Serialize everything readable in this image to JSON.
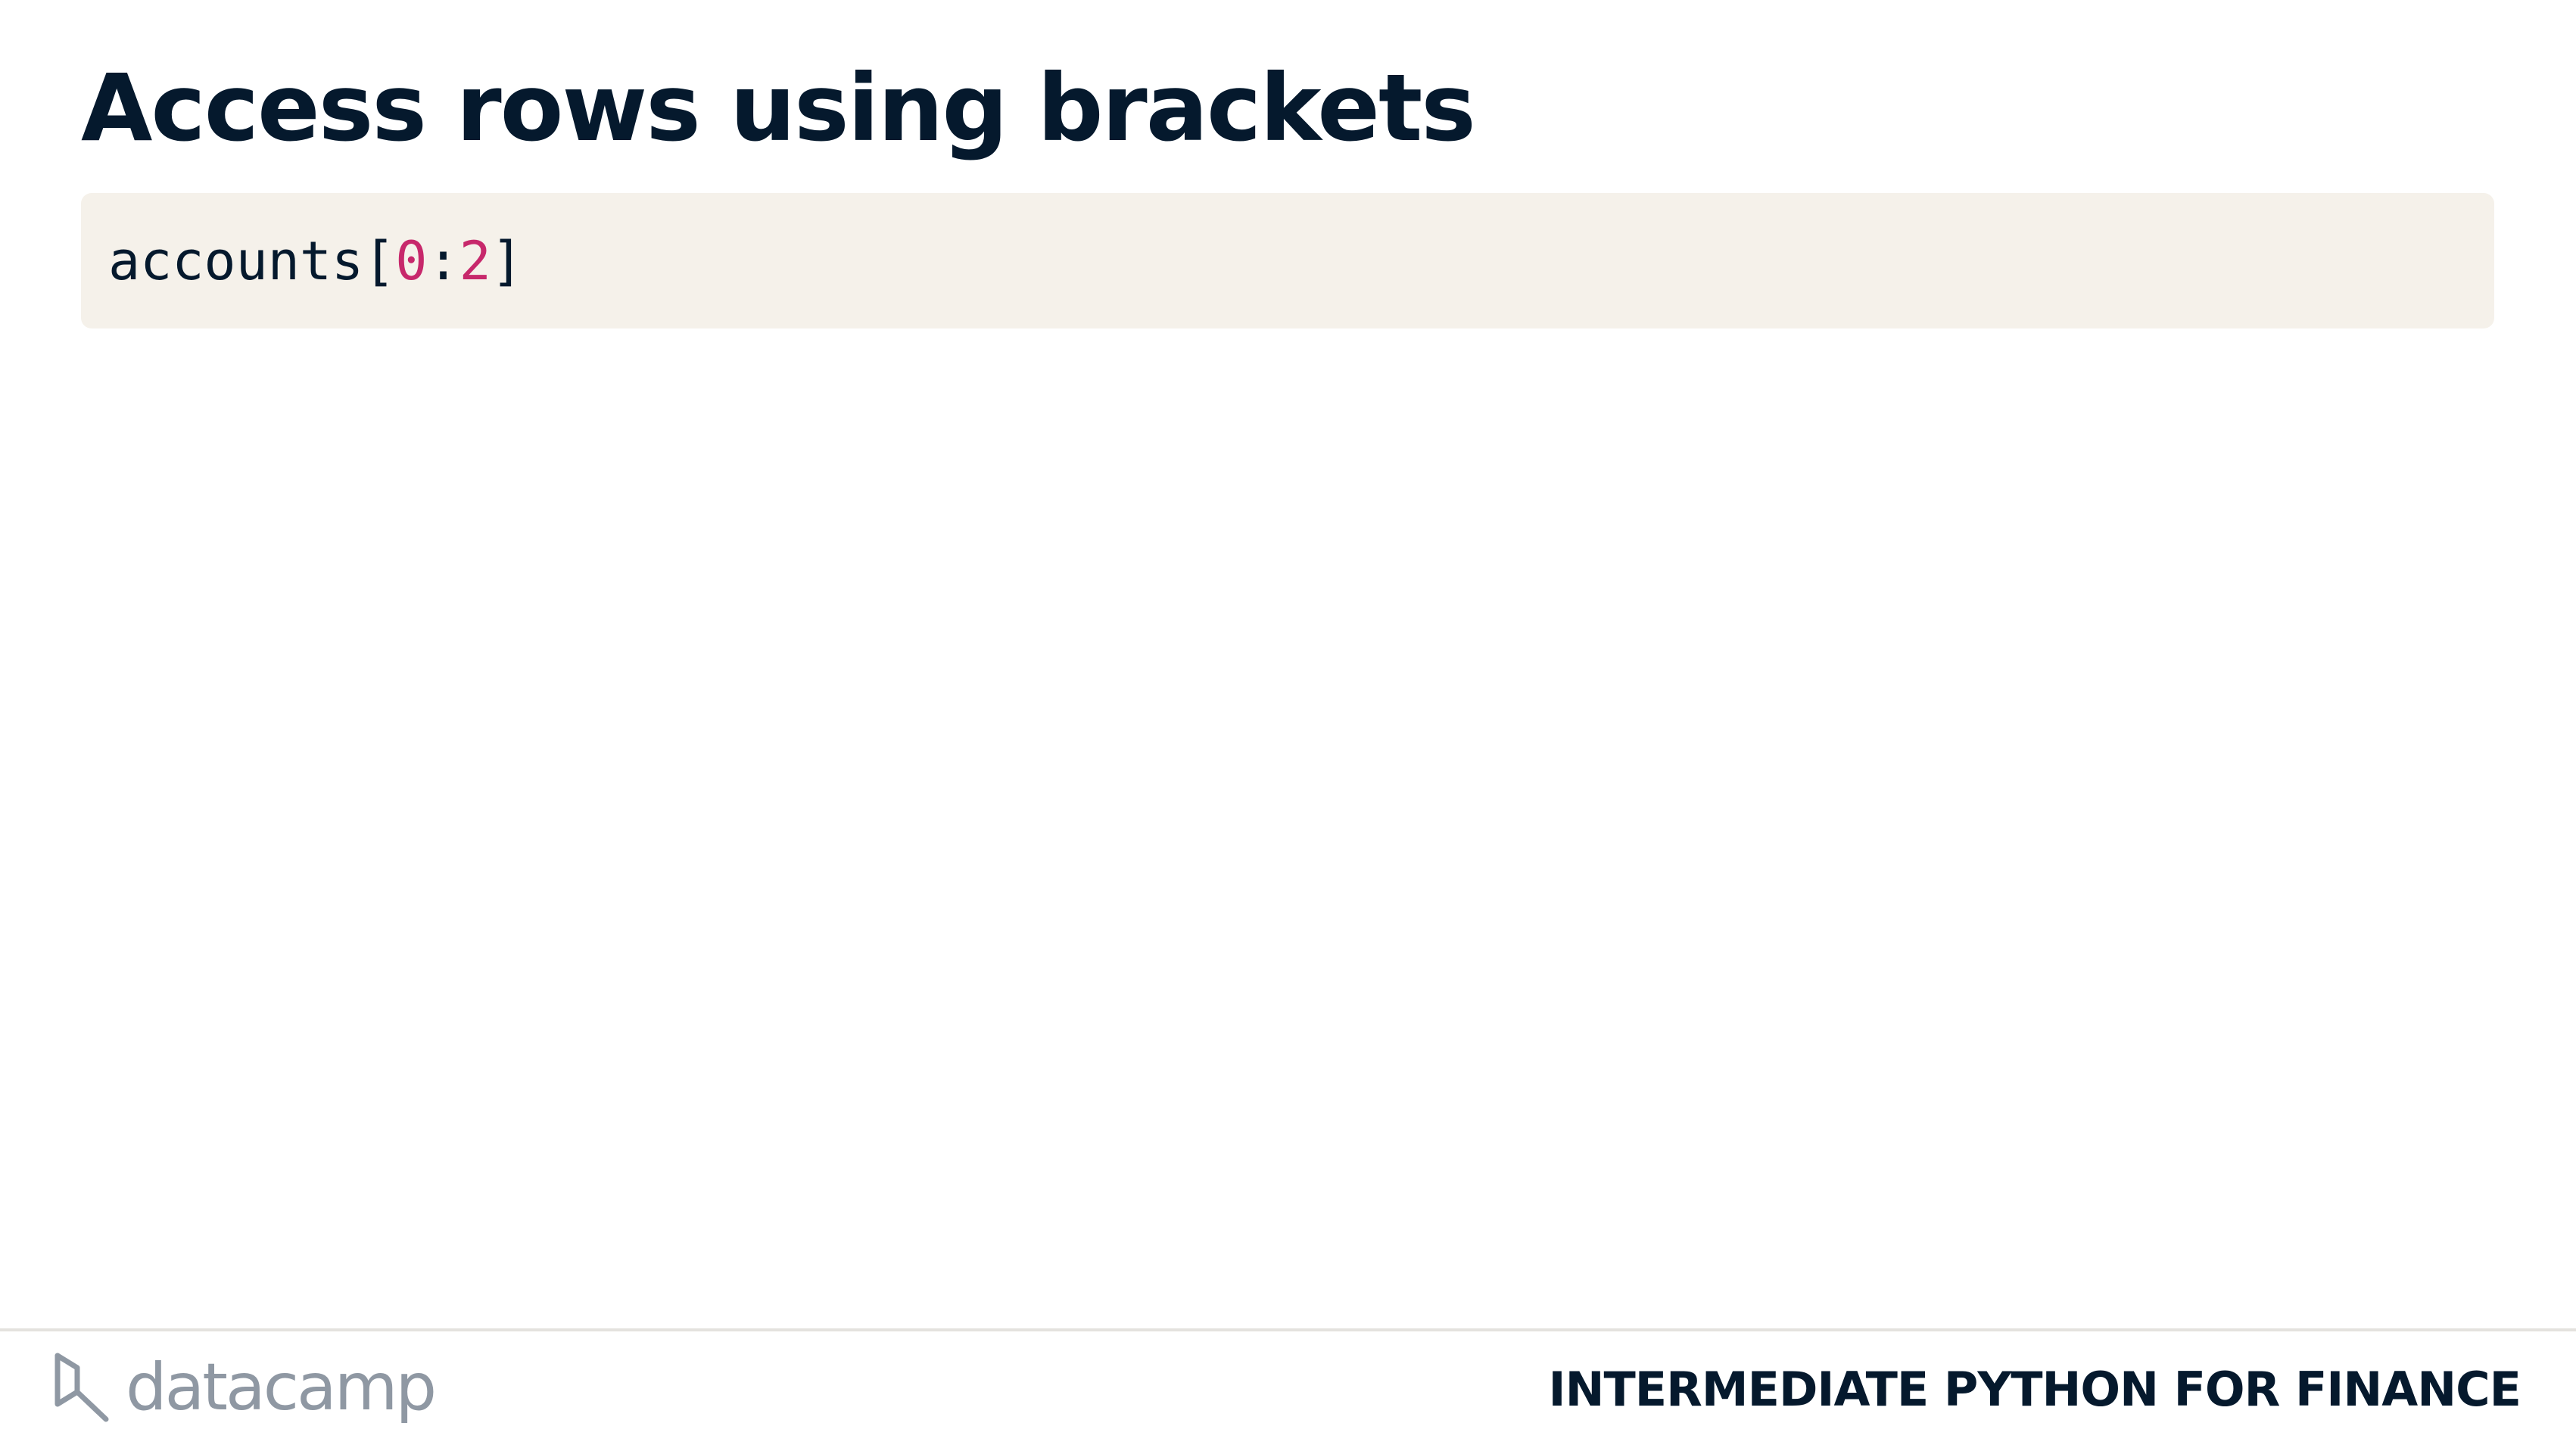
{
  "slide": {
    "title": "Access rows using brackets"
  },
  "code": {
    "prefix": "accounts[",
    "start": "0",
    "separator": ":",
    "stop": "2",
    "suffix": "]"
  },
  "footer": {
    "logo_text": "datacamp",
    "logo_icon": "datacamp-logo-icon",
    "course_title": "INTERMEDIATE PYTHON FOR FINANCE"
  },
  "colors": {
    "title": "#05192d",
    "code_background": "#f5f1ea",
    "code_number": "#c7286b",
    "logo": "#8f98a3"
  }
}
